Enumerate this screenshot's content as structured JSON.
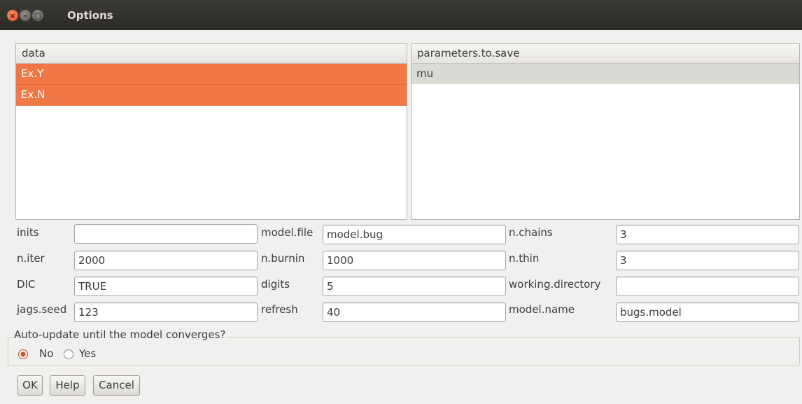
{
  "window": {
    "title": "Options"
  },
  "data_list": {
    "header": "data",
    "items": [
      "Ex.Y",
      "Ex.N"
    ]
  },
  "params_list": {
    "header": "parameters.to.save",
    "items": [
      "mu"
    ]
  },
  "fields": {
    "inits": {
      "label": "inits",
      "value": ""
    },
    "model_file": {
      "label": "model.file",
      "value": "model.bug"
    },
    "n_chains": {
      "label": "n.chains",
      "value": "3"
    },
    "n_iter": {
      "label": "n.iter",
      "value": "2000"
    },
    "n_burnin": {
      "label": "n.burnin",
      "value": "1000"
    },
    "n_thin": {
      "label": "n.thin",
      "value": "3"
    },
    "dic": {
      "label": "DIC",
      "value": "TRUE"
    },
    "digits": {
      "label": "digits",
      "value": "5"
    },
    "working_directory": {
      "label": "working.directory",
      "value": ""
    },
    "jags_seed": {
      "label": "jags.seed",
      "value": "123"
    },
    "refresh": {
      "label": "refresh",
      "value": "40"
    },
    "model_name": {
      "label": "model.name",
      "value": "bugs.model"
    }
  },
  "auto_update": {
    "title": "Auto-update until the model converges?",
    "options": [
      "No",
      "Yes"
    ],
    "selected": "No"
  },
  "buttons": {
    "ok": "OK",
    "help": "Help",
    "cancel": "Cancel"
  }
}
